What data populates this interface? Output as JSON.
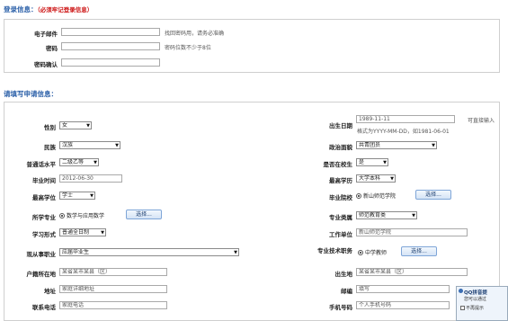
{
  "login_section": {
    "title": "登录信息：",
    "note": "（必须牢记登录信息）",
    "email": {
      "label": "电子邮件",
      "hint": "找回密码用，请务必准确"
    },
    "password": {
      "label": "密码",
      "hint": "密码位数不少于8位"
    },
    "confirm": {
      "label": "密码确认"
    }
  },
  "apply_section": {
    "title": "请填写申请信息：",
    "gender": {
      "label": "性别",
      "value": "女"
    },
    "birth": {
      "label": "出生日期",
      "value": "1989-11-11",
      "tip": "可直接输入",
      "format": "格式为YYYY-MM-DD，如1981-06-01"
    },
    "ethnicity": {
      "label": "民族",
      "value": "汉族"
    },
    "political": {
      "label": "政治面貌",
      "value": "共青团员"
    },
    "mandarin": {
      "label": "普通话水平",
      "value": "二级乙等"
    },
    "in_school": {
      "label": "是否在校生",
      "value": "是"
    },
    "grad_time": {
      "label": "毕业时间",
      "value": "2012-06-30"
    },
    "education": {
      "label": "最高学历",
      "value": "大学本科"
    },
    "degree": {
      "label": "最高学位",
      "value": "学士"
    },
    "grad_school": {
      "label": "毕业院校",
      "value": "新山师范学院",
      "button": "选择..."
    },
    "major": {
      "label": "所学专业",
      "value": "数学与应用数学",
      "button": "选择..."
    },
    "major_category": {
      "label": "专业类属",
      "value": "师范教育类"
    },
    "study_form": {
      "label": "学习形式",
      "value": "普通全日制"
    },
    "work_unit": {
      "label": "工作单位",
      "value": "新山师范学院"
    },
    "current_job": {
      "label": "现从事职业",
      "value": "应届毕业生"
    },
    "title_rank": {
      "label": "专业技术职务",
      "value": "中学教师",
      "button": "选择..."
    },
    "hukou": {
      "label": "户籍所在地",
      "value": "某省某市某县（区）"
    },
    "birthplace": {
      "label": "出生地",
      "value": "某省某市某县（区）"
    },
    "address": {
      "label": "地址",
      "value": "家庭详细地址"
    },
    "postcode": {
      "label": "邮编",
      "value": "填写"
    },
    "phone": {
      "label": "联系电话",
      "value": "家庭电话"
    },
    "mobile": {
      "label": "手机号码",
      "value": "个人手机号码"
    }
  },
  "qq_popup": {
    "title": "QQ拼音提",
    "body": "您可以通过",
    "checkbox": "不再提示"
  },
  "colors": {
    "section_title": "#2a5fa8",
    "note_red": "#cc1111",
    "button_border": "#7fa6d8"
  }
}
